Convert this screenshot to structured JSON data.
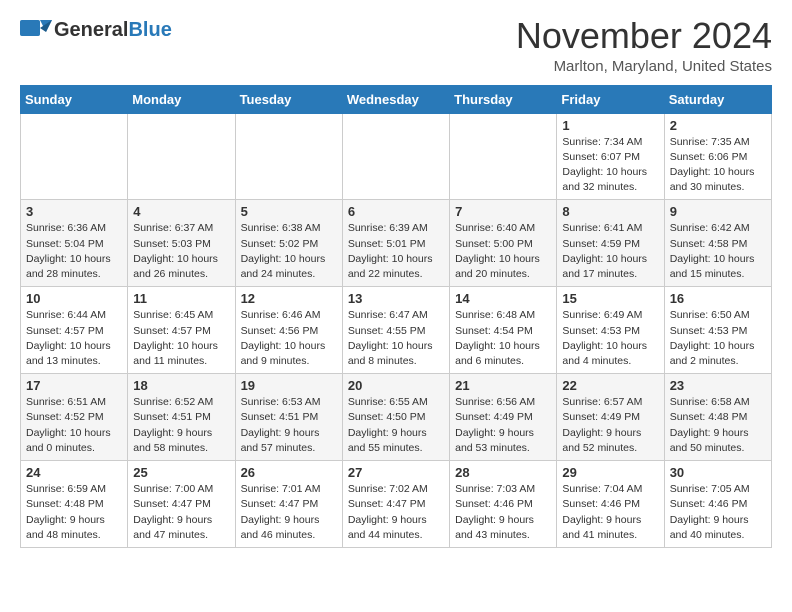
{
  "header": {
    "logo_general": "General",
    "logo_blue": "Blue",
    "month_title": "November 2024",
    "location": "Marlton, Maryland, United States"
  },
  "weekdays": [
    "Sunday",
    "Monday",
    "Tuesday",
    "Wednesday",
    "Thursday",
    "Friday",
    "Saturday"
  ],
  "weeks": [
    [
      {
        "day": "",
        "info": ""
      },
      {
        "day": "",
        "info": ""
      },
      {
        "day": "",
        "info": ""
      },
      {
        "day": "",
        "info": ""
      },
      {
        "day": "",
        "info": ""
      },
      {
        "day": "1",
        "info": "Sunrise: 7:34 AM\nSunset: 6:07 PM\nDaylight: 10 hours\nand 32 minutes."
      },
      {
        "day": "2",
        "info": "Sunrise: 7:35 AM\nSunset: 6:06 PM\nDaylight: 10 hours\nand 30 minutes."
      }
    ],
    [
      {
        "day": "3",
        "info": "Sunrise: 6:36 AM\nSunset: 5:04 PM\nDaylight: 10 hours\nand 28 minutes."
      },
      {
        "day": "4",
        "info": "Sunrise: 6:37 AM\nSunset: 5:03 PM\nDaylight: 10 hours\nand 26 minutes."
      },
      {
        "day": "5",
        "info": "Sunrise: 6:38 AM\nSunset: 5:02 PM\nDaylight: 10 hours\nand 24 minutes."
      },
      {
        "day": "6",
        "info": "Sunrise: 6:39 AM\nSunset: 5:01 PM\nDaylight: 10 hours\nand 22 minutes."
      },
      {
        "day": "7",
        "info": "Sunrise: 6:40 AM\nSunset: 5:00 PM\nDaylight: 10 hours\nand 20 minutes."
      },
      {
        "day": "8",
        "info": "Sunrise: 6:41 AM\nSunset: 4:59 PM\nDaylight: 10 hours\nand 17 minutes."
      },
      {
        "day": "9",
        "info": "Sunrise: 6:42 AM\nSunset: 4:58 PM\nDaylight: 10 hours\nand 15 minutes."
      }
    ],
    [
      {
        "day": "10",
        "info": "Sunrise: 6:44 AM\nSunset: 4:57 PM\nDaylight: 10 hours\nand 13 minutes."
      },
      {
        "day": "11",
        "info": "Sunrise: 6:45 AM\nSunset: 4:57 PM\nDaylight: 10 hours\nand 11 minutes."
      },
      {
        "day": "12",
        "info": "Sunrise: 6:46 AM\nSunset: 4:56 PM\nDaylight: 10 hours\nand 9 minutes."
      },
      {
        "day": "13",
        "info": "Sunrise: 6:47 AM\nSunset: 4:55 PM\nDaylight: 10 hours\nand 8 minutes."
      },
      {
        "day": "14",
        "info": "Sunrise: 6:48 AM\nSunset: 4:54 PM\nDaylight: 10 hours\nand 6 minutes."
      },
      {
        "day": "15",
        "info": "Sunrise: 6:49 AM\nSunset: 4:53 PM\nDaylight: 10 hours\nand 4 minutes."
      },
      {
        "day": "16",
        "info": "Sunrise: 6:50 AM\nSunset: 4:53 PM\nDaylight: 10 hours\nand 2 minutes."
      }
    ],
    [
      {
        "day": "17",
        "info": "Sunrise: 6:51 AM\nSunset: 4:52 PM\nDaylight: 10 hours\nand 0 minutes."
      },
      {
        "day": "18",
        "info": "Sunrise: 6:52 AM\nSunset: 4:51 PM\nDaylight: 9 hours\nand 58 minutes."
      },
      {
        "day": "19",
        "info": "Sunrise: 6:53 AM\nSunset: 4:51 PM\nDaylight: 9 hours\nand 57 minutes."
      },
      {
        "day": "20",
        "info": "Sunrise: 6:55 AM\nSunset: 4:50 PM\nDaylight: 9 hours\nand 55 minutes."
      },
      {
        "day": "21",
        "info": "Sunrise: 6:56 AM\nSunset: 4:49 PM\nDaylight: 9 hours\nand 53 minutes."
      },
      {
        "day": "22",
        "info": "Sunrise: 6:57 AM\nSunset: 4:49 PM\nDaylight: 9 hours\nand 52 minutes."
      },
      {
        "day": "23",
        "info": "Sunrise: 6:58 AM\nSunset: 4:48 PM\nDaylight: 9 hours\nand 50 minutes."
      }
    ],
    [
      {
        "day": "24",
        "info": "Sunrise: 6:59 AM\nSunset: 4:48 PM\nDaylight: 9 hours\nand 48 minutes."
      },
      {
        "day": "25",
        "info": "Sunrise: 7:00 AM\nSunset: 4:47 PM\nDaylight: 9 hours\nand 47 minutes."
      },
      {
        "day": "26",
        "info": "Sunrise: 7:01 AM\nSunset: 4:47 PM\nDaylight: 9 hours\nand 46 minutes."
      },
      {
        "day": "27",
        "info": "Sunrise: 7:02 AM\nSunset: 4:47 PM\nDaylight: 9 hours\nand 44 minutes."
      },
      {
        "day": "28",
        "info": "Sunrise: 7:03 AM\nSunset: 4:46 PM\nDaylight: 9 hours\nand 43 minutes."
      },
      {
        "day": "29",
        "info": "Sunrise: 7:04 AM\nSunset: 4:46 PM\nDaylight: 9 hours\nand 41 minutes."
      },
      {
        "day": "30",
        "info": "Sunrise: 7:05 AM\nSunset: 4:46 PM\nDaylight: 9 hours\nand 40 minutes."
      }
    ]
  ]
}
